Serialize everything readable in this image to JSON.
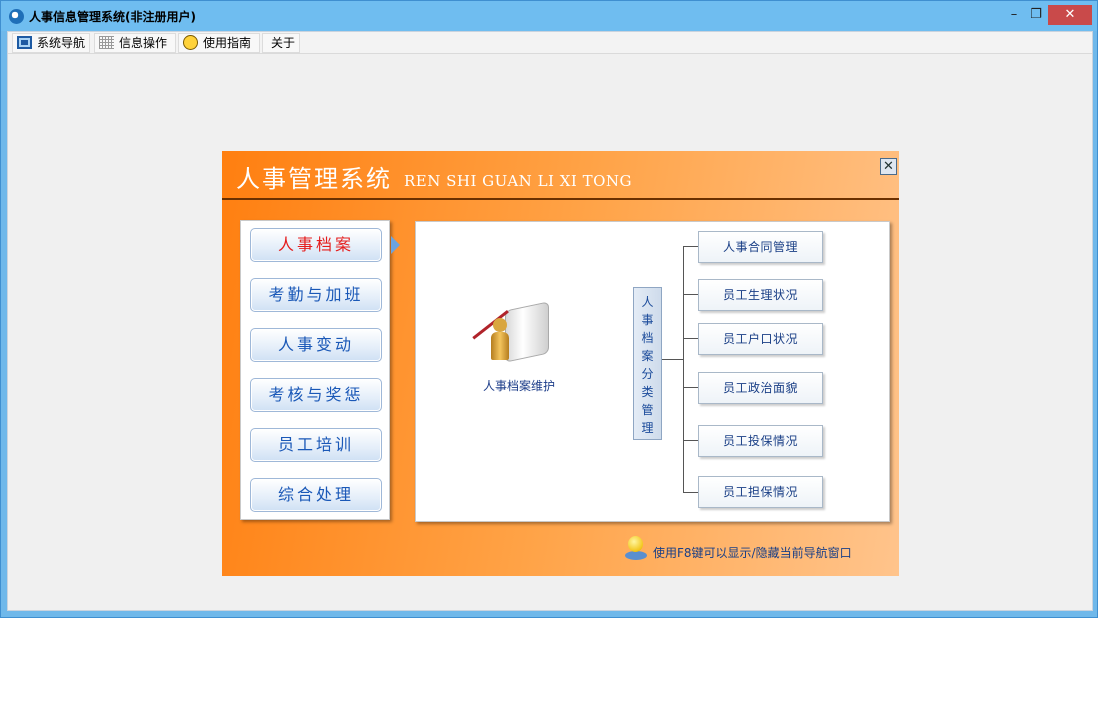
{
  "window": {
    "title": "人事信息管理系统(非注册用户)",
    "controls": {
      "minimize": "–",
      "maximize": "❐",
      "close": "✕"
    }
  },
  "menubar": {
    "items": [
      {
        "label": "系统导航",
        "icon": "monitor-icon"
      },
      {
        "label": "信息操作",
        "icon": "grid-icon"
      },
      {
        "label": "使用指南",
        "icon": "clock-icon"
      },
      {
        "label": "关于",
        "icon": ""
      }
    ]
  },
  "panel": {
    "title": "人事管理系统",
    "subtitle": "REN SHI GUAN LI XI TONG",
    "close_glyph": "✕",
    "colors": {
      "gradient_start": "#ff7f10",
      "gradient_end": "#ffc48c",
      "active_category": "#e51c1c",
      "category_text": "#1a58b7"
    },
    "categories": [
      {
        "label": "人事档案",
        "active": true
      },
      {
        "label": "考勤与加班",
        "active": false
      },
      {
        "label": "人事变动",
        "active": false
      },
      {
        "label": "考核与奖惩",
        "active": false
      },
      {
        "label": "员工培训",
        "active": false
      },
      {
        "label": "综合处理",
        "active": false
      }
    ],
    "feature": {
      "label": "人事档案维护",
      "icon": "archive-person-icon"
    },
    "group_label": "人事档案分类管理",
    "group_chars": [
      "人",
      "事",
      "档",
      "案",
      "分",
      "类",
      "管",
      "理"
    ],
    "subitems": [
      "人事合同管理",
      "员工生理状况",
      "员工户口状况",
      "员工政治面貌",
      "员工投保情况",
      "员工担保情况"
    ],
    "hint": "使用F8键可以显示/隐藏当前导航窗口"
  }
}
